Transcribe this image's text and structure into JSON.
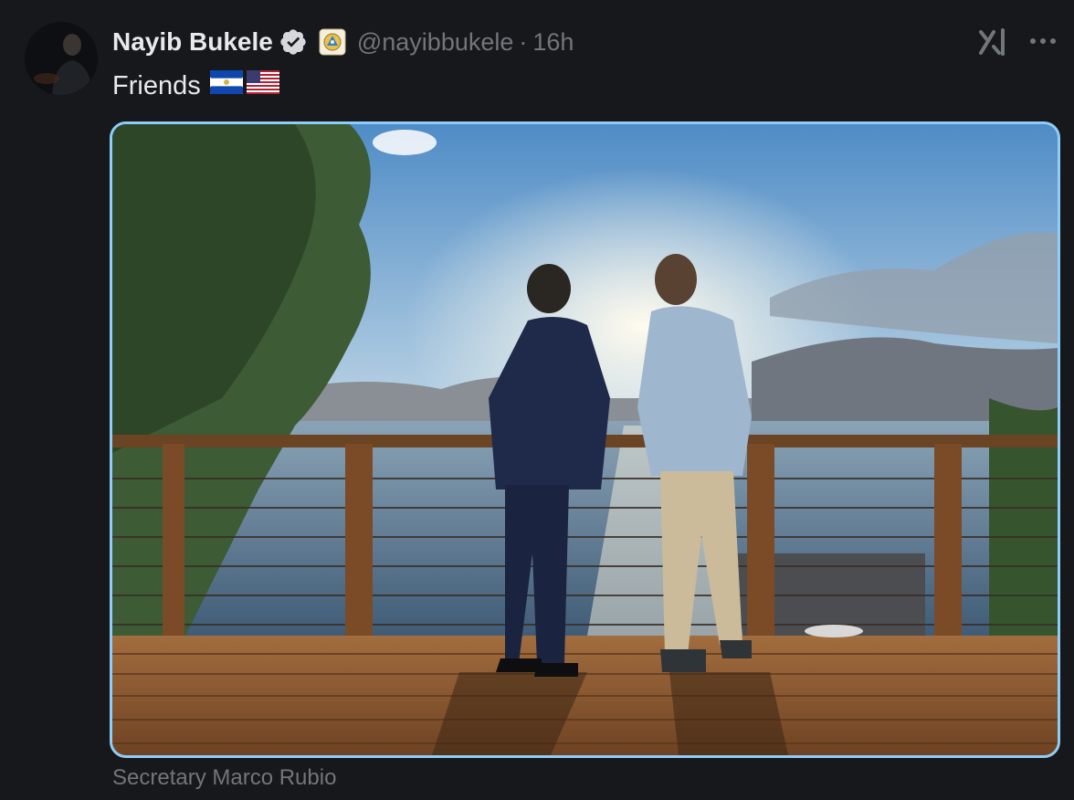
{
  "post": {
    "author": {
      "display_name": "Nayib Bukele",
      "handle": "@nayibbukele",
      "verified_icon": "verified-badge-icon",
      "affiliate_icon": "el-salvador-coat-of-arms-icon"
    },
    "separator": "·",
    "timestamp": "16h",
    "text": "Friends",
    "flags": [
      "el-salvador-flag",
      "us-flag"
    ],
    "media": {
      "description_icon": "photo",
      "border_color": "#8ecdf8"
    },
    "caption": "Secretary Marco Rubio"
  },
  "toolbar": {
    "grok_icon": "grok-icon",
    "more_icon": "more-options-icon"
  },
  "colors": {
    "background": "#16181c",
    "primary_text": "#e7e9ea",
    "secondary_text": "#71767b",
    "verified_blue": "#1d9bf0"
  }
}
